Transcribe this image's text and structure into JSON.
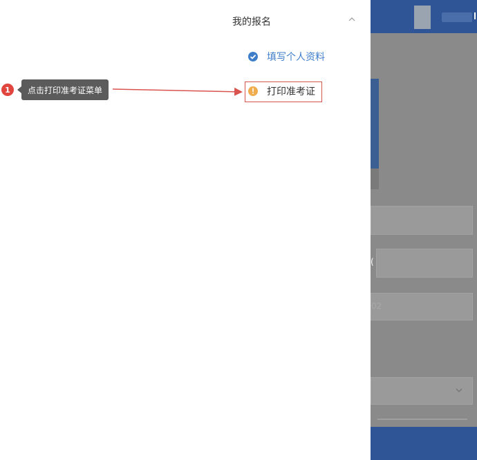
{
  "drawer": {
    "title": "我的报名",
    "items": [
      {
        "label": "填写个人资料",
        "status": "completed",
        "icon": "check-circle-icon"
      },
      {
        "label": "打印准考证",
        "status": "pending",
        "icon": "warning-circle-icon"
      }
    ]
  },
  "annotation": {
    "step_number": "1",
    "tooltip": "点击打印准考证菜单"
  },
  "background_page": {
    "field_value_fragment": "02"
  },
  "colors": {
    "primary": "#2f5596",
    "link": "#3e7ec9",
    "warning": "#f0ad4e",
    "highlight": "#d9534f"
  }
}
